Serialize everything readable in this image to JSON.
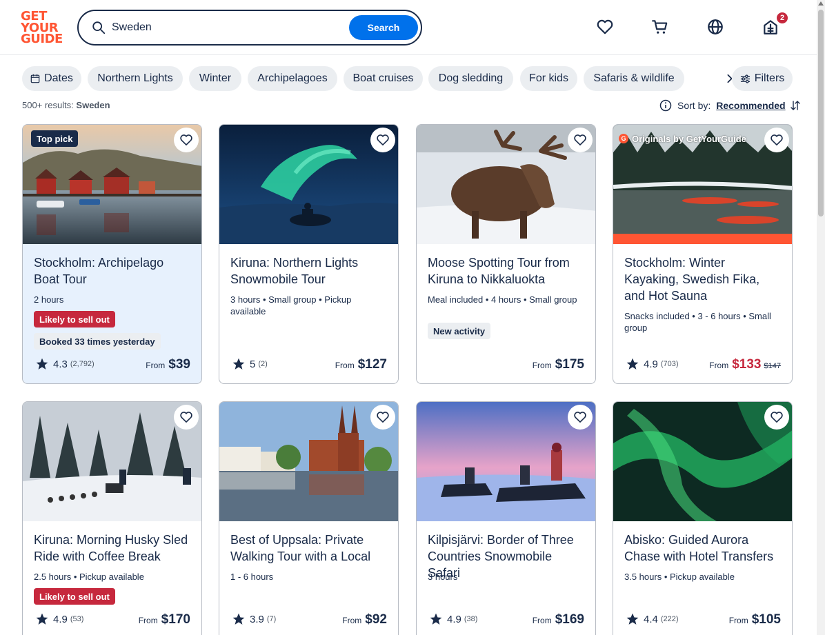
{
  "logo": {
    "line1": "GET",
    "line2": "YOUR",
    "line3": "GUIDE"
  },
  "search": {
    "value": "Sweden",
    "button": "Search"
  },
  "header": {
    "cart_badge": "2"
  },
  "chips": [
    "Dates",
    "Northern Lights",
    "Winter",
    "Archipelagoes",
    "Boat cruises",
    "Dog sledding",
    "For kids",
    "Safaris & wildlife"
  ],
  "filters_label": "Filters",
  "results": {
    "count": "500+ results:",
    "query": "Sweden"
  },
  "sort": {
    "label": "Sort by:",
    "value": "Recommended"
  },
  "colors": {
    "brand": "#ff5533",
    "primary": "#0071eb",
    "urgent": "#c6283d",
    "navy": "#1a2b49"
  },
  "cards": [
    {
      "title": "Stockholm: Archipelago Boat Tour",
      "tag": "Top pick",
      "meta": "2 hours",
      "pill_red": "Likely to sell out",
      "pill_grey": "Booked 33 times yesterday",
      "rating": "4.3",
      "reviews": "(2,792)",
      "from": "From",
      "price": "$39"
    },
    {
      "title": "Kiruna: Northern Lights Snowmobile Tour",
      "meta": "3 hours • Small group • Pickup available",
      "rating": "5",
      "reviews": "(2)",
      "from": "From",
      "price": "$127"
    },
    {
      "title": "Moose Spotting Tour from Kiruna to Nikkaluokta",
      "meta": "Meal included • 4 hours • Small group",
      "pill_grey": "New activity",
      "from": "From",
      "price": "$175"
    },
    {
      "title": "Stockholm: Winter Kayaking, Swedish Fika, and Hot Sauna",
      "tag_orig": "Originals by GetYourGuide",
      "tag_orig_g": "G",
      "meta": "Snacks included • 3 - 6 hours • Small group",
      "rating": "4.9",
      "reviews": "(703)",
      "from": "From",
      "price": "$133",
      "old_price": "$147"
    },
    {
      "title": "Kiruna: Morning Husky Sled Ride with Coffee Break",
      "meta": "2.5 hours • Pickup available",
      "pill_red": "Likely to sell out",
      "rating": "4.9",
      "reviews": "(53)",
      "from": "From",
      "price": "$170"
    },
    {
      "title": "Best of Uppsala: Private Walking Tour with a Local",
      "meta": "1 - 6 hours",
      "rating": "3.9",
      "reviews": "(7)",
      "from": "From",
      "price": "$92"
    },
    {
      "title": "Kilpisjärvi: Border of Three Countries Snowmobile Safari",
      "meta": "3 hours",
      "rating": "4.9",
      "reviews": "(38)",
      "from": "From",
      "price": "$169"
    },
    {
      "title": "Abisko: Guided Aurora Chase with Hotel Transfers",
      "meta": "3.5 hours • Pickup available",
      "rating": "4.4",
      "reviews": "(222)",
      "from": "From",
      "price": "$105"
    }
  ]
}
